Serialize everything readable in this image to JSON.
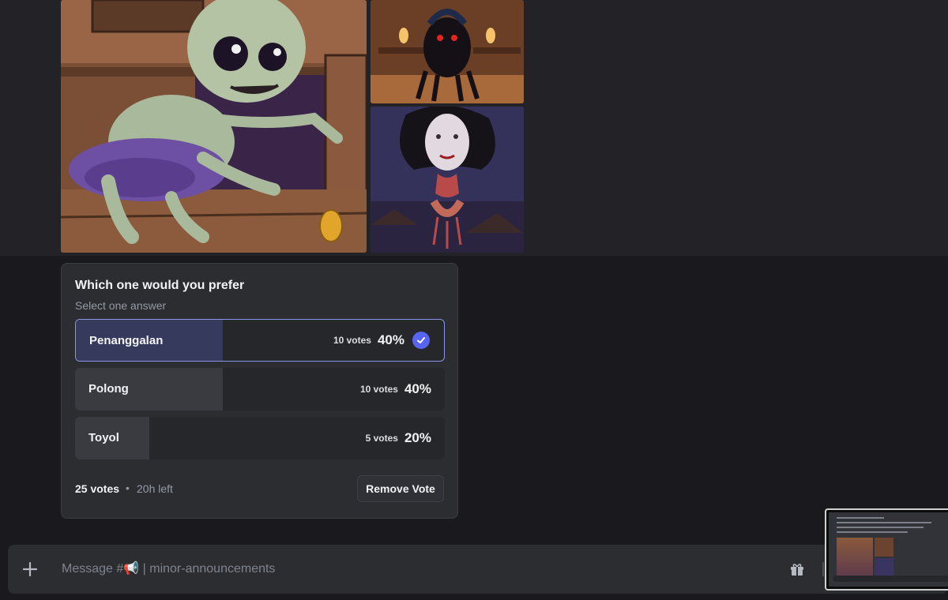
{
  "images": [
    {
      "description_name": "toyol-illustration"
    },
    {
      "description_name": "polong-illustration"
    },
    {
      "description_name": "penanggalan-illustration"
    }
  ],
  "poll": {
    "question": "Which one would you prefer",
    "subtitle": "Select one answer",
    "options": [
      {
        "label": "Penanggalan",
        "votes": "10 votes",
        "percent": "40%",
        "fill": 0.4,
        "selected": true
      },
      {
        "label": "Polong",
        "votes": "10 votes",
        "percent": "40%",
        "fill": 0.4,
        "selected": false
      },
      {
        "label": "Toyol",
        "votes": "5 votes",
        "percent": "20%",
        "fill": 0.2,
        "selected": false
      }
    ],
    "total_votes": "25 votes",
    "separator": "•",
    "time_left": "20h left",
    "remove_vote_label": "Remove Vote"
  },
  "composer": {
    "placeholder": "Message #📢 | minor-announcements"
  },
  "icons": {
    "plus": "plus-icon",
    "gift": "gift-icon",
    "check": "check-icon"
  },
  "colors": {
    "accent": "#5865f2",
    "selected_border": "#8a95e8"
  }
}
